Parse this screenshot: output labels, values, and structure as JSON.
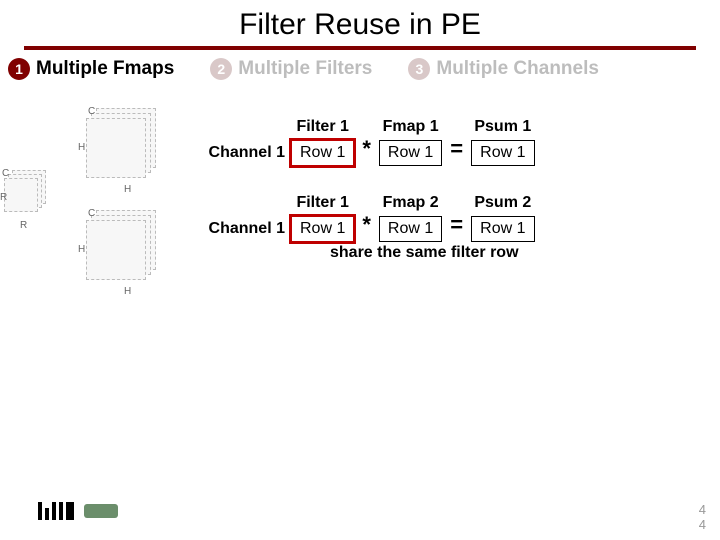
{
  "title": "Filter Reuse in PE",
  "subheads": {
    "s1": {
      "num": "1",
      "label": "Multiple Fmaps"
    },
    "s2": {
      "num": "2",
      "label": "Multiple Filters"
    },
    "s3": {
      "num": "3",
      "label": "Multiple Channels"
    }
  },
  "dim_labels": {
    "C": "C",
    "H": "H",
    "R": "R"
  },
  "eq1": {
    "channel": "Channel 1",
    "filter_head": "Filter 1",
    "filter_val": "Row 1",
    "fmap_head": "Fmap 1",
    "fmap_val": "Row 1",
    "psum_head": "Psum 1",
    "psum_val": "Row 1",
    "star": "*",
    "eq": "="
  },
  "eq2": {
    "channel": "Channel 1",
    "filter_head": "Filter 1",
    "filter_val": "Row 1",
    "fmap_head": "Fmap 2",
    "fmap_val": "Row 1",
    "psum_head": "Psum 2",
    "psum_val": "Row 1",
    "star": "*",
    "eq": "="
  },
  "share_text": "share the same filter row",
  "page": {
    "a": "4",
    "b": "4"
  }
}
